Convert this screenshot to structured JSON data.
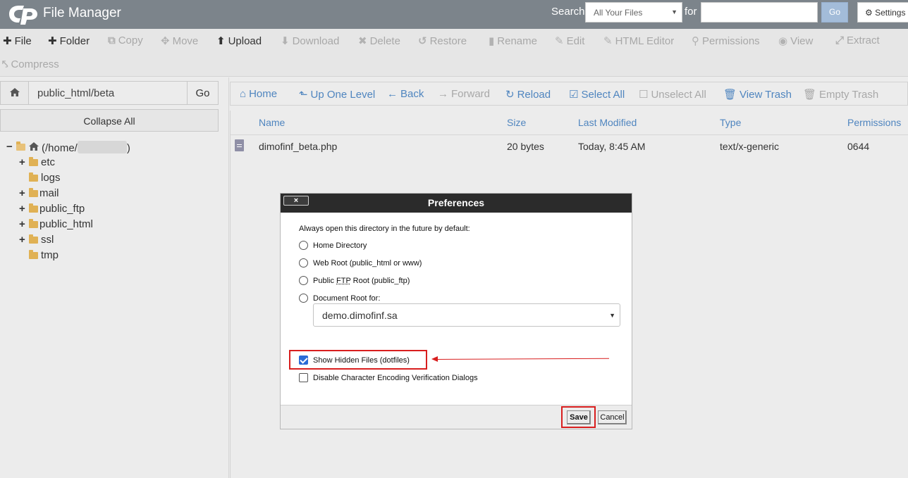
{
  "header": {
    "title": "File Manager",
    "search_label": "Search",
    "search_scope": "All Your Files",
    "for_label": "for",
    "search_value": "",
    "go_label": "Go",
    "settings_label": "Settings",
    "bg_color": "#7c848b"
  },
  "toolbar": {
    "row1": [
      {
        "label": "File",
        "icon": "plus-icon",
        "enabled": true
      },
      {
        "label": "Folder",
        "icon": "plus-icon",
        "enabled": true
      },
      {
        "label": "Copy",
        "icon": "copy-icon",
        "enabled": false
      },
      {
        "label": "Move",
        "icon": "move-icon",
        "enabled": false
      },
      {
        "label": "Upload",
        "icon": "upload-icon",
        "enabled": true
      },
      {
        "label": "Download",
        "icon": "download-icon",
        "enabled": false
      },
      {
        "label": "Delete",
        "icon": "delete-icon",
        "enabled": false
      },
      {
        "label": "Restore",
        "icon": "restore-icon",
        "enabled": false
      },
      {
        "label": "Rename",
        "icon": "rename-icon",
        "enabled": false
      },
      {
        "label": "Edit",
        "icon": "edit-icon",
        "enabled": false
      },
      {
        "label": "HTML Editor",
        "icon": "html-editor-icon",
        "enabled": false
      },
      {
        "label": "Permissions",
        "icon": "key-icon",
        "enabled": false
      },
      {
        "label": "View",
        "icon": "eye-icon",
        "enabled": false
      },
      {
        "label": "Extract",
        "icon": "extract-icon",
        "enabled": false
      }
    ],
    "row2": [
      {
        "label": "Compress",
        "icon": "compress-icon",
        "enabled": false
      }
    ]
  },
  "sidebar": {
    "path_value": "public_html/beta",
    "go_label": "Go",
    "collapse_label": "Collapse All",
    "root_label_prefix": "(/home/",
    "root_label_suffix": ")",
    "tree": [
      {
        "label": "etc",
        "expandable": true
      },
      {
        "label": "logs",
        "expandable": false
      },
      {
        "label": "mail",
        "expandable": true
      },
      {
        "label": "public_ftp",
        "expandable": true
      },
      {
        "label": "public_html",
        "expandable": true
      },
      {
        "label": "ssl",
        "expandable": true
      },
      {
        "label": "tmp",
        "expandable": false
      }
    ]
  },
  "nav": [
    {
      "label": "Home",
      "icon": "home-icon",
      "enabled": true
    },
    {
      "label": "Up One Level",
      "icon": "up-level-icon",
      "enabled": true
    },
    {
      "label": "Back",
      "icon": "back-arrow-icon",
      "enabled": true
    },
    {
      "label": "Forward",
      "icon": "forward-arrow-icon",
      "enabled": false
    },
    {
      "label": "Reload",
      "icon": "reload-icon",
      "enabled": true
    },
    {
      "label": "Select All",
      "icon": "checkbox-checked-icon",
      "enabled": true
    },
    {
      "label": "Unselect All",
      "icon": "checkbox-empty-icon",
      "enabled": false
    },
    {
      "label": "View Trash",
      "icon": "trash-icon",
      "enabled": true
    },
    {
      "label": "Empty Trash",
      "icon": "trash-icon",
      "enabled": false
    }
  ],
  "files": {
    "columns": [
      "Name",
      "Size",
      "Last Modified",
      "Type",
      "Permissions"
    ],
    "rows": [
      {
        "name": "dimofinf_beta.php",
        "size": "20 bytes",
        "modified": "Today, 8:45 AM",
        "type": "text/x-generic",
        "perms": "0644"
      }
    ]
  },
  "dialog": {
    "title": "Preferences",
    "close_label": "×",
    "intro": "Always open this directory in the future by default:",
    "options": {
      "home": "Home Directory",
      "webroot": "Web Root (public_html or www)",
      "ftp_prefix": "Public ",
      "ftp_abbr": "FTP",
      "ftp_suffix": " Root (public_ftp)",
      "docroot": "Document Root for:"
    },
    "domain_value": "demo.dimofinf.sa",
    "show_hidden_label": "Show Hidden Files (dotfiles)",
    "show_hidden_checked": true,
    "disable_encoding_label": "Disable Character Encoding Verification Dialogs",
    "disable_encoding_checked": false,
    "save_label": "Save",
    "cancel_label": "Cancel",
    "highlight_color": "#d81e1e"
  }
}
